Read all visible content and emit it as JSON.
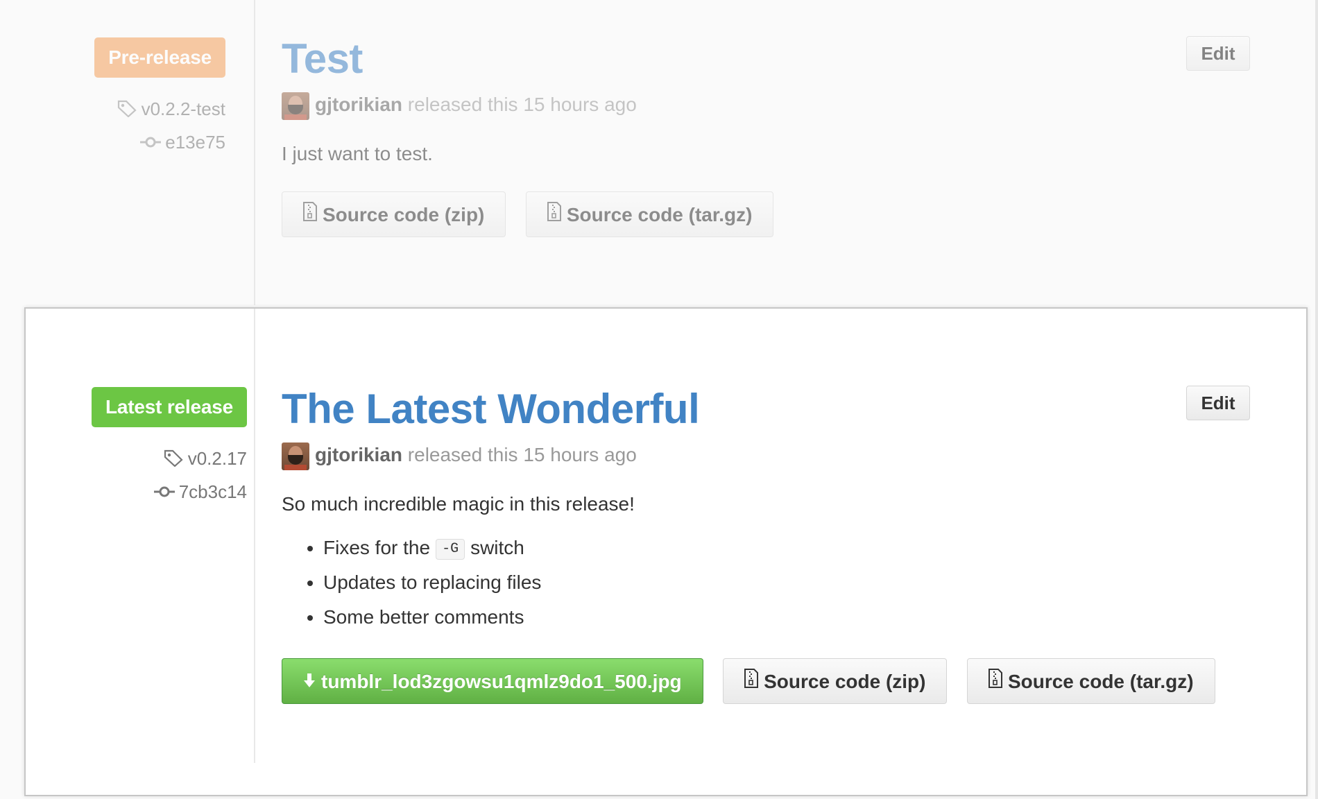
{
  "releases": {
    "pre": {
      "badge": "Pre-release",
      "tag": "v0.2.2-test",
      "commit": "e13e75",
      "title": "Test",
      "author": "gjtorikian",
      "released_text": "released this 15 hours ago",
      "description": "I just want to test.",
      "edit_label": "Edit",
      "downloads": [
        {
          "label": "Source code (zip)",
          "icon": "file-zip-icon"
        },
        {
          "label": "Source code (tar.gz)",
          "icon": "file-zip-icon"
        }
      ]
    },
    "latest": {
      "badge": "Latest release",
      "tag": "v0.2.17",
      "commit": "7cb3c14",
      "title": "The Latest Wonderful",
      "author": "gjtorikian",
      "released_text": "released this 15 hours ago",
      "description": "So much incredible magic in this release!",
      "bullets": {
        "b1_prefix": "Fixes for the",
        "b1_code": "-G",
        "b1_suffix": "switch",
        "b2": "Updates to replacing files",
        "b3": "Some better comments"
      },
      "edit_label": "Edit",
      "asset": {
        "label": "tumblr_lod3zgowsu1qmlz9do1_500.jpg",
        "icon": "download-arrow-icon"
      },
      "downloads": [
        {
          "label": "Source code (zip)",
          "icon": "file-zip-icon"
        },
        {
          "label": "Source code (tar.gz)",
          "icon": "file-zip-icon"
        }
      ]
    }
  },
  "colors": {
    "title_blue": "#4183c4",
    "prerelease_orange": "#f3a15c",
    "latest_green": "#6cc644"
  }
}
